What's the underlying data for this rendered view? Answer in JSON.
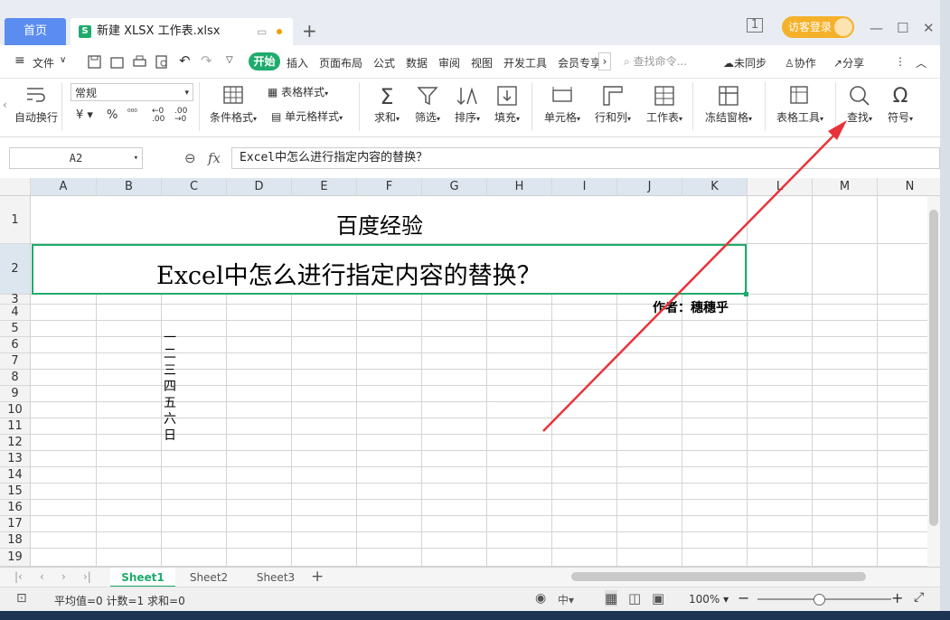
{
  "titlebar": {
    "home_tab": "首页",
    "file_logo": "S",
    "file_tab": "新建 XLSX 工作表.xlsx",
    "login": "访客登录"
  },
  "menu": {
    "file": "文件",
    "start": "开始",
    "items": [
      "插入",
      "页面布局",
      "公式",
      "数据",
      "审阅",
      "视图",
      "开发工具",
      "会员专享"
    ],
    "search_placeholder": "查找命令...",
    "sync": "未同步",
    "collab": "协作",
    "share": "分享"
  },
  "ribbon": {
    "autowrap": "自动换行",
    "number_format": "常规",
    "table_style": "表格样式",
    "cond_format": "条件格式",
    "cell_style": "单元格样式",
    "sum": "求和",
    "filter": "筛选",
    "sort": "排序",
    "fill": "填充",
    "cell": "单元格",
    "rowcol": "行和列",
    "worksheet": "工作表",
    "freeze": "冻结窗格",
    "table_tools": "表格工具",
    "find": "查找",
    "symbol": "符号"
  },
  "formula": {
    "cell_ref": "A2",
    "fx": "fx",
    "content": "Excel中怎么进行指定内容的替换？"
  },
  "columns": [
    "A",
    "B",
    "C",
    "D",
    "E",
    "F",
    "G",
    "H",
    "I",
    "J",
    "K",
    "L",
    "M",
    "N"
  ],
  "rows": [
    "1",
    "2",
    "3",
    "4",
    "5",
    "6",
    "7",
    "8",
    "9",
    "10",
    "11",
    "12",
    "13",
    "14",
    "15",
    "16",
    "17",
    "18",
    "19"
  ],
  "cells": {
    "r1": "百度经验",
    "r2": "Excel中怎么进行指定内容的替换？",
    "r3": "作者：穗穗乎",
    "c_list": [
      "一",
      "二",
      "三",
      "四",
      "五",
      "六",
      "日"
    ]
  },
  "sheets": {
    "active": "Sheet1",
    "others": [
      "Sheet2",
      "Sheet3"
    ]
  },
  "status": {
    "summary": "平均值=0  计数=1  求和=0",
    "zoom": "100%"
  },
  "colors": {
    "accent_green": "#1fab6d",
    "home_blue": "#5b8df0",
    "arrow_red": "#e8333a"
  }
}
